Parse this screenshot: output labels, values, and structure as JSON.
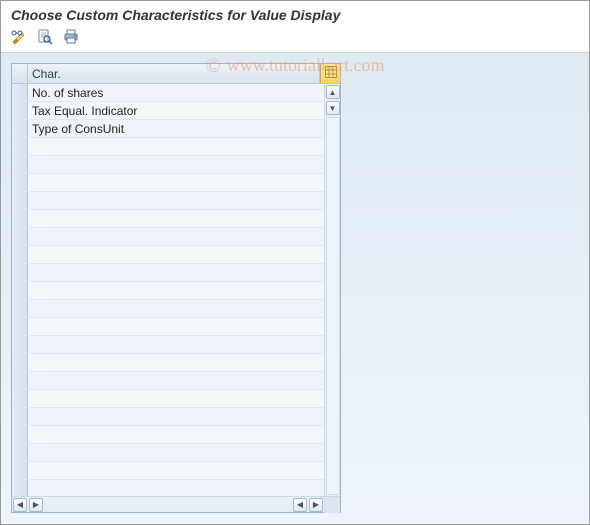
{
  "title": "Choose Custom Characteristics for Value Display",
  "watermark": "www.tutorialkart.com",
  "toolbar": {
    "edit_tooltip": "Change",
    "find_tooltip": "Find",
    "print_tooltip": "Print"
  },
  "grid": {
    "column_header": "Char.",
    "rows": [
      "No. of shares",
      "Tax Equal. Indicator",
      "Type of ConsUnit"
    ],
    "empty_row_count": 20
  }
}
